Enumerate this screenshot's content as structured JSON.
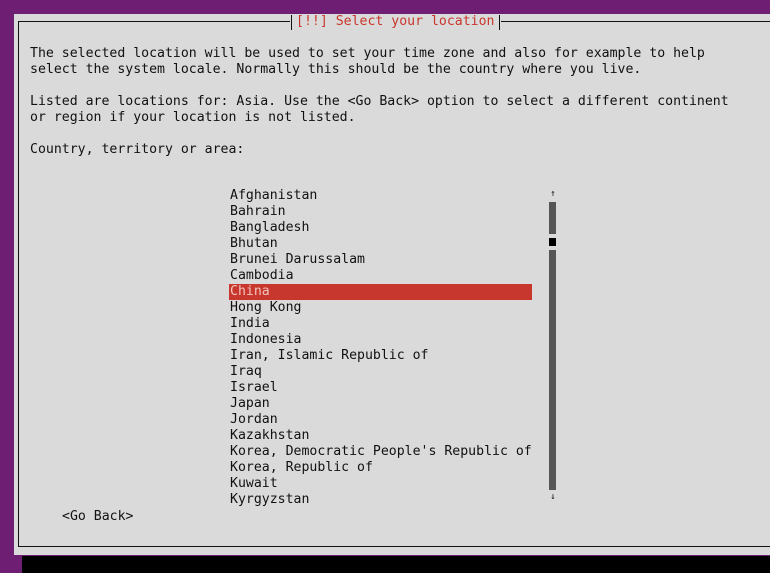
{
  "dialog": {
    "title": "[!!] Select your location",
    "intro_line1": "The selected location will be used to set your time zone and also for example to help",
    "intro_line2": "select the system locale. Normally this should be the country where you live.",
    "listed_line1": "Listed are locations for: Asia. Use the <Go Back> option to select a different continent",
    "listed_line2": "or region if your location is not listed.",
    "prompt": "Country, territory or area:",
    "go_back": "<Go Back>"
  },
  "countries": {
    "selected": "China",
    "items": [
      "Afghanistan",
      "Bahrain",
      "Bangladesh",
      "Bhutan",
      "Brunei Darussalam",
      "Cambodia",
      "China",
      "Hong Kong",
      "India",
      "Indonesia",
      "Iran, Islamic Republic of",
      "Iraq",
      "Israel",
      "Japan",
      "Jordan",
      "Kazakhstan",
      "Korea, Democratic People's Republic of",
      "Korea, Republic of",
      "Kuwait",
      "Kyrgyzstan"
    ]
  },
  "scrollbar": {
    "up_icon": "arrow-up-icon",
    "down_icon": "arrow-down-icon"
  },
  "colors": {
    "desktop": "#6e1f74",
    "dialog": "#dadada",
    "accent": "#c8372d",
    "selected_text": "#f1c4bd"
  }
}
